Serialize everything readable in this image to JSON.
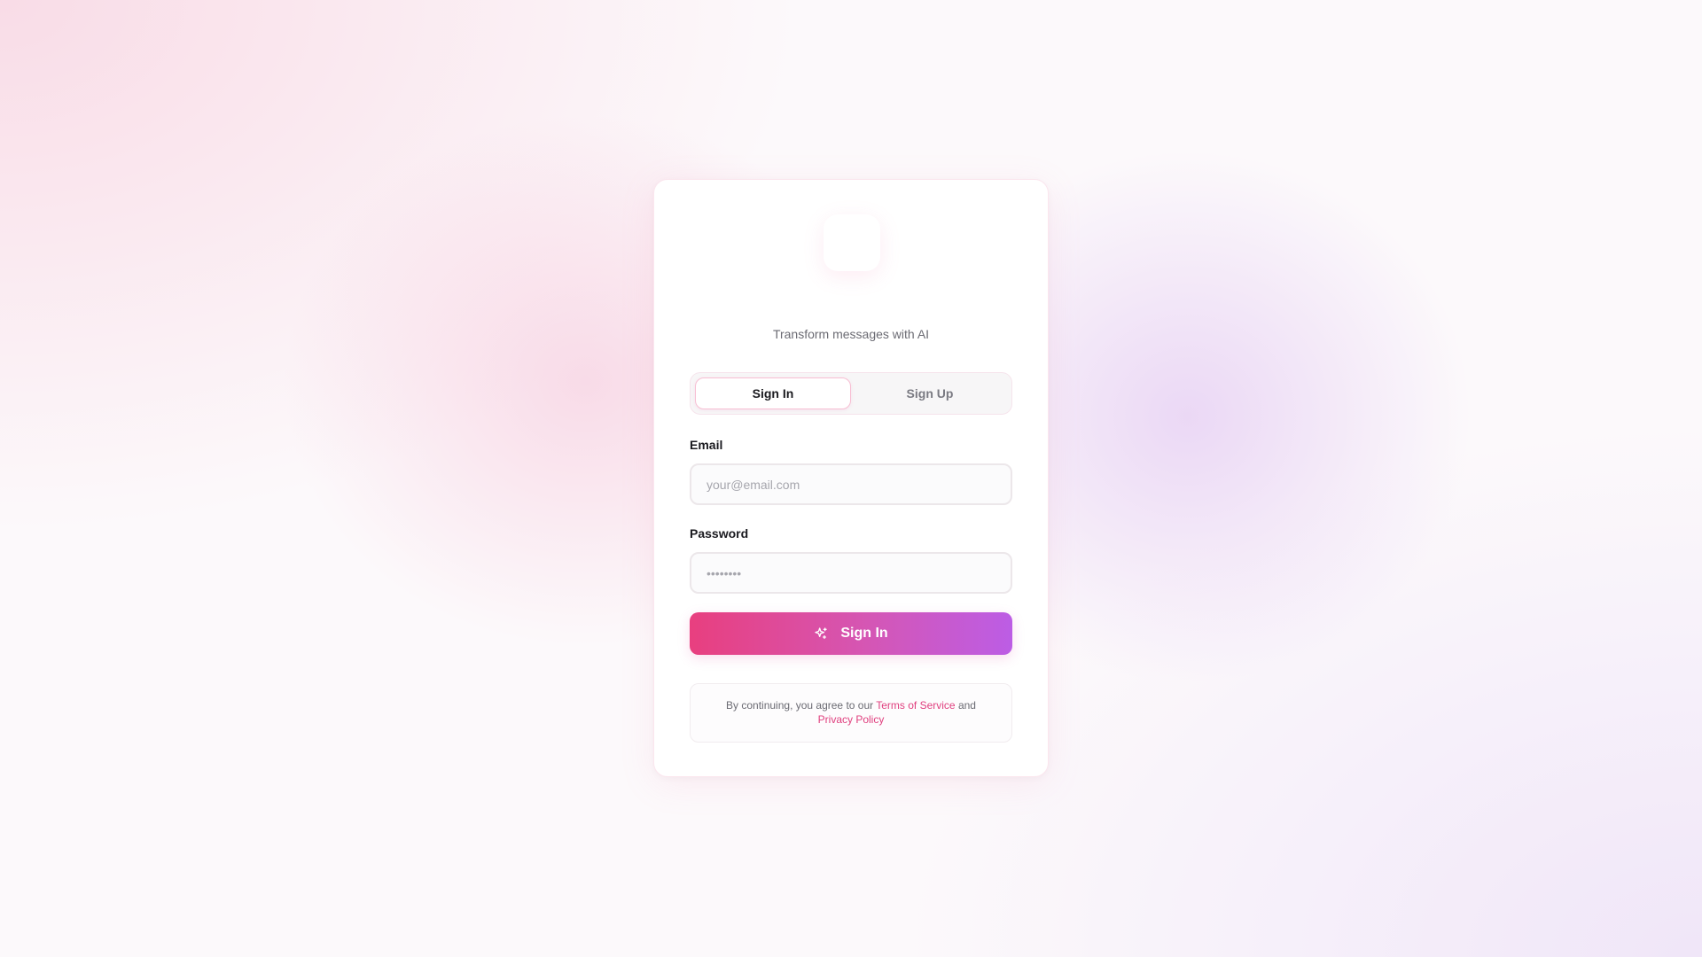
{
  "app": {
    "subtitle": "Transform messages with AI"
  },
  "tabs": [
    {
      "label": "Sign In",
      "active": true
    },
    {
      "label": "Sign Up",
      "active": false
    }
  ],
  "form": {
    "email_label": "Email",
    "email_placeholder": "your@email.com",
    "password_label": "Password",
    "password_placeholder": "••••••••",
    "submit_label": "Sign In",
    "submit_icon": "sparkles-icon"
  },
  "terms": {
    "prefix": "By continuing, you agree to our ",
    "terms_link": "Terms of Service",
    "middle": " and ",
    "privacy_link": "Privacy Policy"
  },
  "colors": {
    "accent_start": "#e83f7f",
    "accent_end": "#bc5de5",
    "link": "#e0407f"
  }
}
